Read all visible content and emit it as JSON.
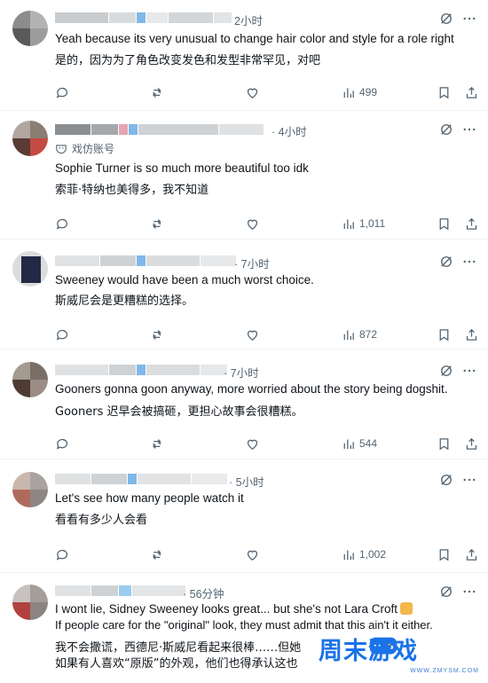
{
  "replies": [
    {
      "time": "2小时",
      "text_en": "Yeah because its very unusual to change hair color and style for a role right",
      "text_zh": "是的，因为为了角色改变发色和发型非常罕见，对吧",
      "views": "499"
    },
    {
      "time": "· 4小时",
      "badge": "戏仿账号",
      "text_en": "Sophie Turner is so much more beautiful too idk",
      "text_zh": "索菲·特纳也美得多，我不知道",
      "views": "1,011"
    },
    {
      "time": "· 7小时",
      "text_en": "Sweeney would have been a much worst choice.",
      "text_zh": "斯威尼会是更糟糕的选择。",
      "views": "872"
    },
    {
      "time": "· 7小时",
      "text_en": "Gooners gonna goon anyway, more worried about the story being dogshit.",
      "text_zh": "Gooners 迟早会被搞砸，更担心故事会很糟糕。",
      "views": "544"
    },
    {
      "time": "· 5小时",
      "text_en": "Let's see how many people watch it",
      "text_zh": "看看有多少人会看",
      "views": "1,002"
    },
    {
      "time": "· 56分钟",
      "text_en": "I wont lie, Sidney Sweeney looks great... but she's not Lara Croft",
      "text_en_2": "If people care for the \"original\" look, they must admit that this ain't it either.",
      "text_zh": "我不会撒谎，西德尼·斯威尼看起来很棒……但她",
      "text_zh_2": "如果有人喜欢“原版”的外观，他们也得承认这也"
    }
  ],
  "watermark": {
    "text": "周末游戏",
    "sub": "WWW.ZMYSM.COM",
    "color_main": "#1a73e8",
    "color_accent": "#f5a623"
  },
  "colors": {
    "text": "#0f1419",
    "muted": "#536471",
    "divider": "#eff3f4"
  }
}
